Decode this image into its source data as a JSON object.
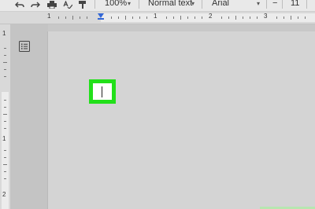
{
  "toolbar": {
    "zoom": "100%",
    "style": "Normal text",
    "font": "Arial",
    "font_size": "11",
    "minus_label": "−",
    "caret": "▾"
  },
  "ruler": {
    "numbers": [
      "1",
      "1",
      "2",
      "3"
    ]
  },
  "vruler": {
    "numbers": [
      "1",
      "1",
      "2"
    ]
  },
  "colors": {
    "highlight": "#22e01a",
    "indent_marker": "#3367d6"
  },
  "icons": [
    "undo-icon",
    "redo-icon",
    "print-icon",
    "spellcheck-icon",
    "paint-format-icon",
    "document-outline-icon"
  ]
}
